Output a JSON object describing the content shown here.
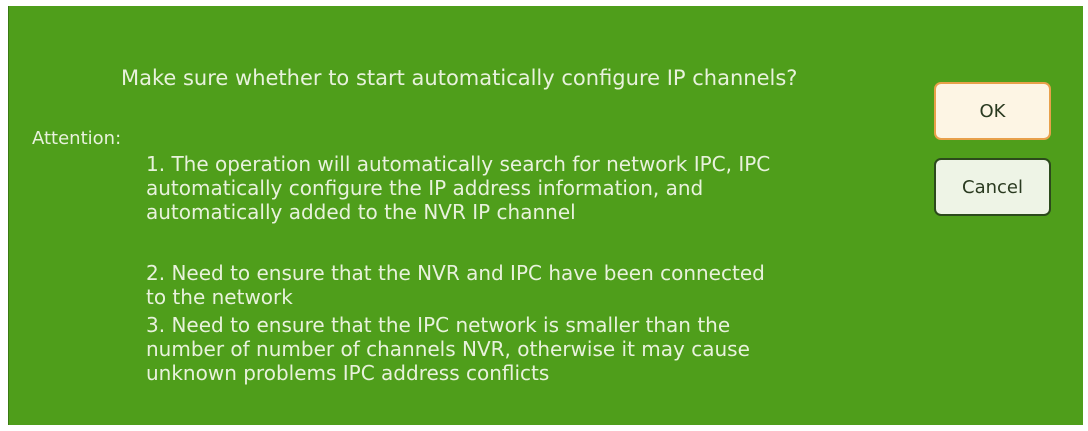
{
  "dialog": {
    "question": "Make sure whether to start automatically configure IP channels?",
    "attention_label": "Attention:",
    "items": [
      {
        "lines": [
          "1. The operation will automatically search for network IPC, IPC",
          "automatically configure the IP address information, and",
          "automatically added to the NVR IP channel"
        ]
      },
      {
        "lines": [
          "2. Need to ensure that the NVR and IPC have been connected",
          "to the network"
        ]
      },
      {
        "lines": [
          "3. Need to ensure that the IPC network is smaller than the",
          "number of number of channels NVR, otherwise it may cause",
          "unknown problems IPC address conflicts"
        ]
      }
    ],
    "buttons": {
      "ok_label": "OK",
      "cancel_label": "Cancel"
    }
  },
  "colors": {
    "background": "#4f9e1b",
    "text": "#e8f2dc",
    "ok_border": "#e8a04a",
    "cancel_border": "#2c4a1c"
  }
}
